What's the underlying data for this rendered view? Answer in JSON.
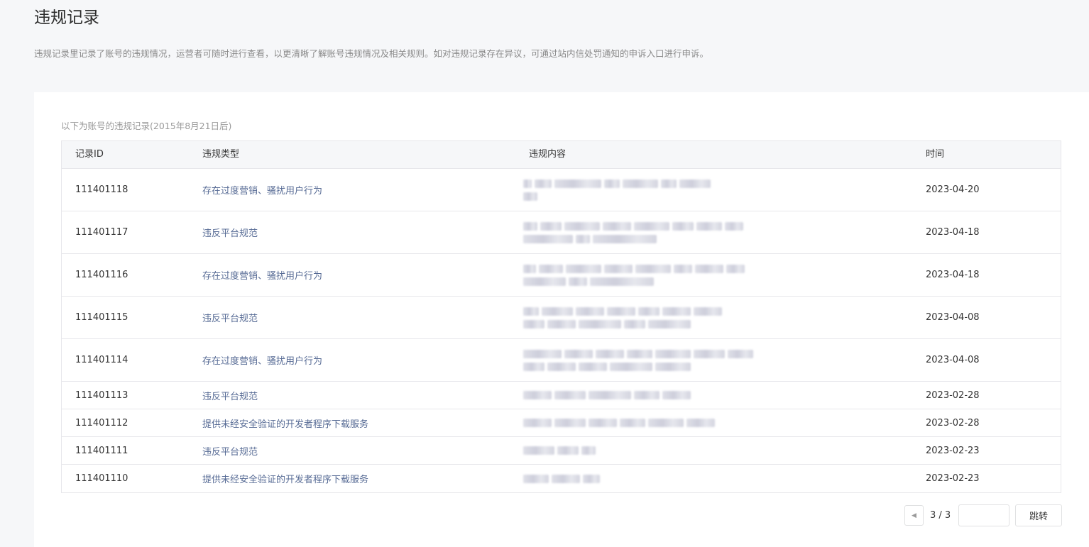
{
  "header": {
    "title": "违规记录",
    "description": "违规记录里记录了账号的违规情况，运营者可随时进行查看，以更清晰了解账号违规情况及相关规则。如对违规记录存在异议，可通过站内信处罚通知的申诉入口进行申诉。"
  },
  "card": {
    "caption": "以下为账号的违规记录(2015年8月21日后)"
  },
  "table": {
    "columns": {
      "id": "记录ID",
      "type": "违规类型",
      "content": "违规内容",
      "time": "时间"
    },
    "rows": [
      {
        "id": "111401118",
        "type": "存在过度营销、骚扰用户行为",
        "time": "2023-04-20"
      },
      {
        "id": "111401117",
        "type": "违反平台规范",
        "time": "2023-04-18"
      },
      {
        "id": "111401116",
        "type": "存在过度营销、骚扰用户行为",
        "time": "2023-04-18"
      },
      {
        "id": "111401115",
        "type": "违反平台规范",
        "time": "2023-04-08"
      },
      {
        "id": "111401114",
        "type": "存在过度营销、骚扰用户行为",
        "time": "2023-04-08"
      },
      {
        "id": "111401113",
        "type": "违反平台规范",
        "time": "2023-02-28"
      },
      {
        "id": "111401112",
        "type": "提供未经安全验证的开发者程序下载服务",
        "time": "2023-02-28"
      },
      {
        "id": "111401111",
        "type": "违反平台规范",
        "time": "2023-02-23"
      },
      {
        "id": "111401110",
        "type": "提供未经安全验证的开发者程序下载服务",
        "time": "2023-02-23"
      }
    ]
  },
  "pager": {
    "prev_icon": "caret-left-icon",
    "page_info": "3 / 3",
    "jump_value": "",
    "jump_label": "跳转"
  }
}
